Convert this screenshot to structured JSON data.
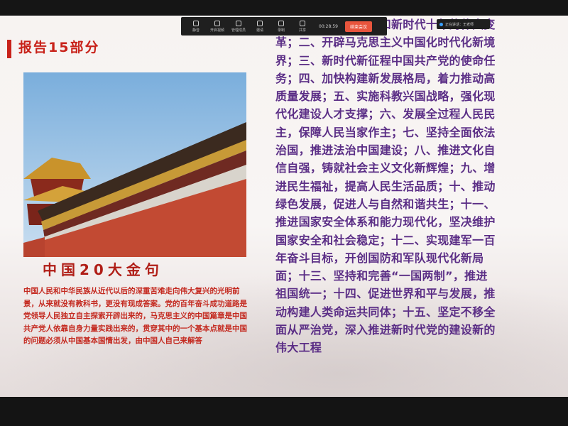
{
  "slide": {
    "report_title": "报告15部分",
    "quote_title": "中国20大金句",
    "quote_body": "中国人民和中华民族从近代以后的深重苦难走向伟大复兴的光明前景，从来就没有教科书，更没有现成答案。党的百年奋斗成功道路是党领导人民独立自主探索开辟出来的，马克思主义的中国篇章是中国共产党人依靠自身力量实践出来的，贯穿其中的一个基本点就是中国的问题必须从中国基本国情出发，由中国人自己来解答",
    "right_text": "一、过去五年的工作和新时代十年的伟大变革；二、开辟马克思主义中国化时代化新境界；三、新时代新征程中国共产党的使命任务；四、加快构建新发展格局，着力推动高质量发展；五、实施科教兴国战略，强化现代化建设人才支撑；六、发展全过程人民民主，保障人民当家作主；七、坚持全面依法治国，推进法治中国建设；八、推进文化自信自强，铸就社会主义文化新辉煌；九、增进民生福祉，提高人民生活品质；十、推动绿色发展，促进人与自然和谐共生；十一、推进国家安全体系和能力现代化，坚决维护国家安全和社会稳定；十二、实现建军一百年奋斗目标，开创国防和军队现代化新局面；十三、坚持和完善“一国两制”，推进祖国统一；十四、促进世界和平与发展，推动构建人类命运共同体；十五、坚定不移全面从严治党，深入推进新时代党的建设新的伟大工程"
  },
  "meeting_toolbar": {
    "items": [
      {
        "label": "静音",
        "icon": "microphone-icon"
      },
      {
        "label": "开启视频",
        "icon": "camera-icon"
      },
      {
        "label": "管理成员",
        "icon": "members-icon"
      },
      {
        "label": "邀请",
        "icon": "invite-icon"
      },
      {
        "label": "录制",
        "icon": "record-icon"
      },
      {
        "label": "共享",
        "icon": "share-icon"
      }
    ],
    "timer": "00:28:59",
    "end_label": "结束会议"
  },
  "meeting_info": {
    "text": "正在讲话：王老师"
  },
  "colors": {
    "accent_red": "#c8221a",
    "body_purple": "#5b2e86",
    "quote_red": "#c42a20"
  }
}
